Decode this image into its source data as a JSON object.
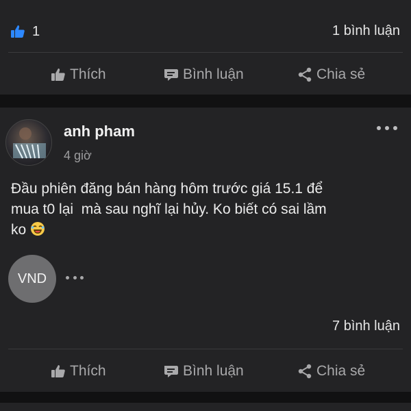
{
  "top_card": {
    "reaction_count": "1",
    "comment_count": "1 bình luận",
    "actions": {
      "like": "Thích",
      "comment": "Bình luận",
      "share": "Chia sẻ"
    }
  },
  "post": {
    "author": "anh pham",
    "time": "4 giờ",
    "text": "Đầu phiên đăng bán hàng hôm trước giá 15.1 để\nmua t0 lại  mà sau nghĩ lại hủy. Ko biết có sai lầm\nko ",
    "tag": "VND",
    "comment_count": "7 bình luận",
    "actions": {
      "like": "Thích",
      "comment": "Bình luận",
      "share": "Chia sẻ"
    }
  },
  "icons": {
    "reaction": "like-badge-icon",
    "like": "thumbs-up-icon",
    "comment": "comment-bubble-icon",
    "share": "share-icon",
    "more": "more-dots-icon",
    "emoji": "laughing-emoji-icon"
  },
  "colors": {
    "background": "#111112",
    "card": "#232325",
    "text": "#ececec",
    "muted": "#a9a9ab",
    "like_blue": "#2d88ff",
    "chip": "#6e6e70"
  }
}
